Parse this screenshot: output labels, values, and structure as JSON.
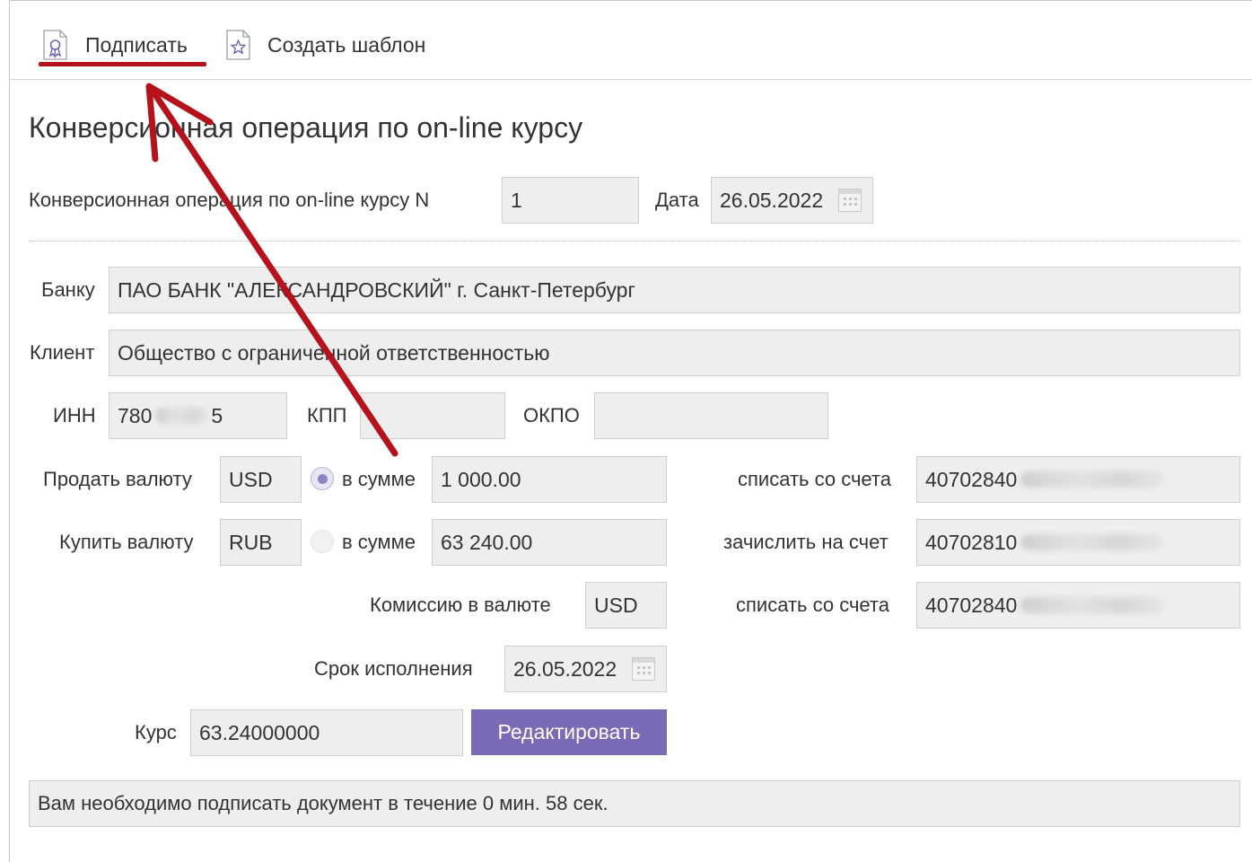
{
  "toolbar": {
    "sign_label": "Подписать",
    "template_label": "Создать шаблон",
    "sign_icon": "document-ribbon-icon",
    "template_icon": "document-star-icon"
  },
  "page_title": "Конверсионная операция по on-line курсу",
  "header": {
    "number_label": "Конверсионная операция по on-line курсу N",
    "number_value": "1",
    "date_label": "Дата",
    "date_value": "26.05.2022"
  },
  "bank": {
    "label": "Банку",
    "value": "ПАО БАНК \"АЛЕКСАНДРОВСКИЙ\" г. Санкт-Петербург"
  },
  "client": {
    "label": "Клиент",
    "value": "Общество с ограниченной ответственностью"
  },
  "inn": {
    "label": "ИНН",
    "value": "780",
    "value_suffix": "5"
  },
  "kpp": {
    "label": "КПП",
    "value": ""
  },
  "okpo": {
    "label": "ОКПО",
    "value": ""
  },
  "sell": {
    "label": "Продать валюту",
    "currency": "USD",
    "amount_label": "в сумме",
    "amount": "1 000.00",
    "selected": true,
    "account_label": "списать со счета",
    "account": "40702840"
  },
  "buy": {
    "label": "Купить валюту",
    "currency": "RUB",
    "amount_label": "в сумме",
    "amount": "63 240.00",
    "selected": false,
    "account_label": "зачислить на счет",
    "account": "40702810"
  },
  "commission": {
    "label": "Комиссию в валюте",
    "currency": "USD",
    "account_label": "списать со счета",
    "account": "40702840"
  },
  "deadline": {
    "label": "Срок исполнения",
    "value": "26.05.2022"
  },
  "rate": {
    "label": "Курс",
    "value": "63.24000000"
  },
  "edit_button": "Редактировать",
  "notice": "Вам необходимо подписать документ в течение 0 мин. 58 сек.",
  "colors": {
    "accent": "#7a6bb6",
    "annotation": "#b5121b",
    "field_bg": "#eeeeee"
  }
}
